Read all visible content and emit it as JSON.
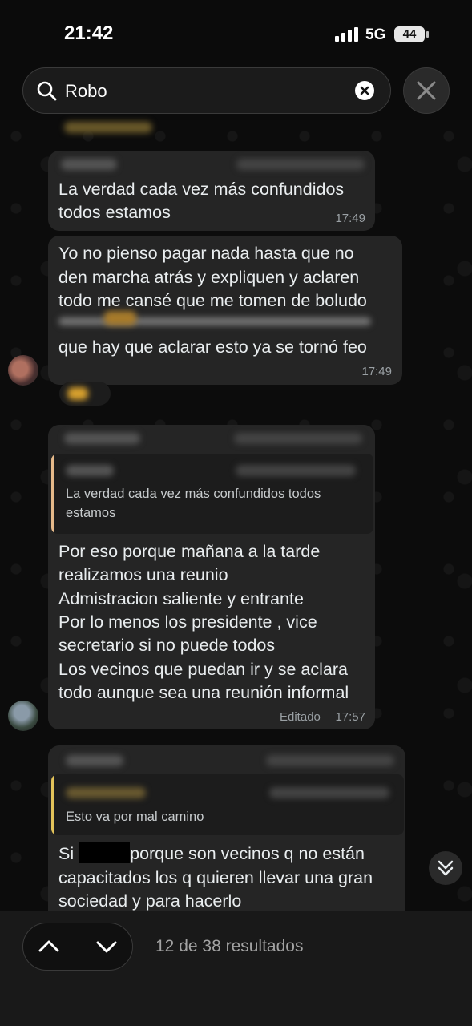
{
  "status_bar": {
    "time": "21:42",
    "network": "5G",
    "battery": "44"
  },
  "search": {
    "query": "Robo"
  },
  "messages": [
    {
      "lines": [
        "La verdad cada vez más confundidos",
        "todos estamos"
      ],
      "time": "17:49"
    },
    {
      "lines": [
        "Yo no pienso pagar nada hasta que no",
        "den marcha atrás y expliquen y aclaren",
        "todo me cansé que me tomen de boludo"
      ],
      "last_line": "que hay que aclarar esto ya se tornó feo",
      "time": "17:49"
    },
    {
      "quote": [
        "La verdad cada vez más confundidos todos",
        "estamos"
      ],
      "lines": [
        "Por eso porque mañana a la tarde",
        "realizamos una reunio",
        "Admistracion saliente y entrante",
        "Por lo menos los presidente , vice",
        "secretario si no puede todos",
        "Los vecinos que puedan ir y se aclara",
        "todo aunque sea una reunión informal"
      ],
      "edited_label": "Editado",
      "time": "17:57"
    },
    {
      "quote": [
        "Esto va por mal camino"
      ],
      "first_line_start": "Si",
      "first_line_end": "porque son  vecinos q no están",
      "lines": [
        "capacitados los q quieren llevar una gran",
        "sociedad y  para hacerlo"
      ]
    }
  ],
  "footer": {
    "results": "12 de 38 resultados"
  },
  "colors": {
    "quote_bar": "#e5b98a",
    "bubble": "#252525",
    "background": "#0b0b0b"
  }
}
